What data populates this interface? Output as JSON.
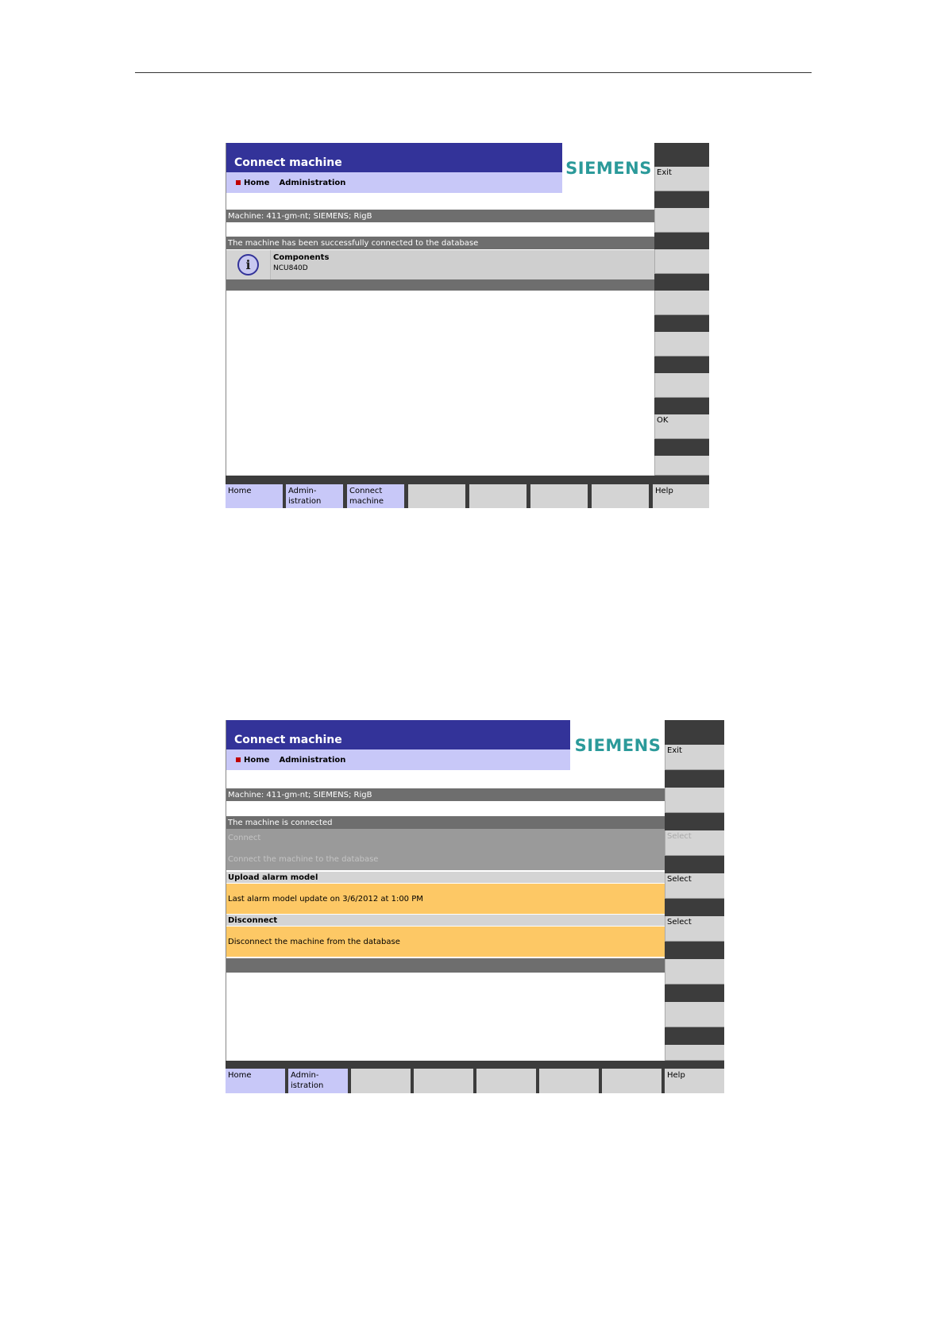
{
  "screen1": {
    "title": "Connect machine",
    "breadcrumb": [
      "Home",
      "Administration"
    ],
    "logo": "SIEMENS",
    "machine_line": "Machine: 411-gm-nt; SIEMENS; RigB",
    "status": "The machine has been successfully connected to the database",
    "info": {
      "title": "Components",
      "detail": "NCU840D",
      "icon": "info-icon"
    },
    "vertical_softkeys": [
      "Exit",
      "",
      "",
      "",
      "",
      "",
      "OK",
      ""
    ],
    "horizontal_softkeys": [
      "Home",
      "Admin-\nistration",
      "Connect\nmachine",
      "",
      "",
      "",
      "",
      "Help"
    ]
  },
  "screen2": {
    "title": "Connect machine",
    "breadcrumb": [
      "Home",
      "Administration"
    ],
    "logo": "SIEMENS",
    "machine_line": "Machine: 411-gm-nt; SIEMENS; RigB",
    "status": "The machine is connected",
    "connect": {
      "title": "Connect",
      "detail": "Connect the machine to the database"
    },
    "upload": {
      "title": "Upload alarm model",
      "detail": "Last alarm model update on 3/6/2012 at 1:00 PM"
    },
    "disconnect": {
      "title": "Disconnect",
      "detail": "Disconnect the machine from the database"
    },
    "vertical_softkeys": [
      "Exit",
      "",
      "Select",
      "Select",
      "Select",
      "",
      "",
      ""
    ],
    "horizontal_softkeys": [
      "Home",
      "Admin-\nistration",
      "",
      "",
      "",
      "",
      "",
      "Help"
    ]
  },
  "colors": {
    "title_bar": "#333399",
    "breadcrumb_bar": "#c8c8f8",
    "logo": "#2b9a9a",
    "option_highlight": "#fdc865"
  }
}
